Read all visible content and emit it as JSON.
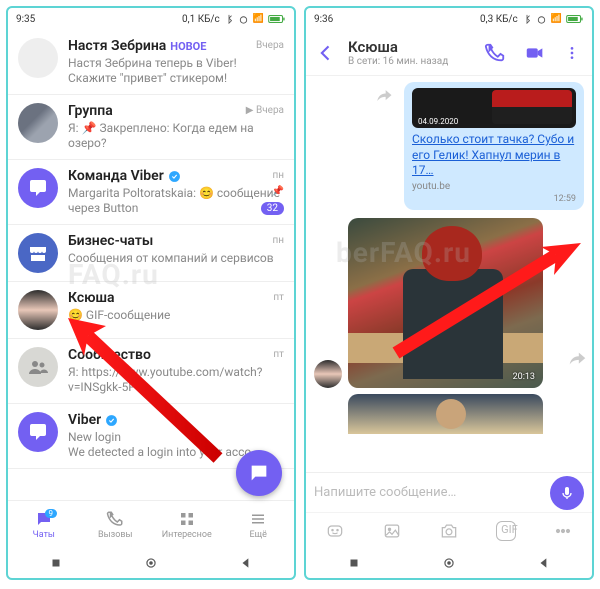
{
  "left": {
    "status": {
      "time": "9:35",
      "net": "0,1 КБ/с"
    },
    "chats": [
      {
        "title": "Настя Зебрина",
        "new": "НОВОЕ",
        "sub": "Настя Зебрина теперь в Viber! Скажите \"привет\" стикером!",
        "meta": "Вчера",
        "avatar": "blank"
      },
      {
        "title": "Группа",
        "sub": "Я: 📌 Закреплено: Когда едем на озеро?",
        "meta": "▶ Вчера",
        "avatar": "photo"
      },
      {
        "title": "Команда Viber",
        "verified": true,
        "sub": "Margarita Poltoratskaia: 😊 сообщение через Button",
        "meta": "пн",
        "count": "32",
        "avatar": "viber"
      },
      {
        "title": "Бизнес-чаты",
        "sub": "Сообщения от компаний и сервисов",
        "meta": "пн",
        "avatar": "biz"
      },
      {
        "title": "Ксюша",
        "sub": "😊 GIF-сообщение",
        "meta": "пт",
        "avatar": "ksu"
      },
      {
        "title": "Сообщество",
        "sub": "Я: https://www.youtube.com/watch?v=INSgkk-5Pco",
        "meta": "пт",
        "avatar": "group"
      },
      {
        "title": "Viber",
        "verified": true,
        "sub": "New login\nWe detected a login into your acco…",
        "meta": "",
        "avatar": "viber"
      }
    ],
    "nav": {
      "chats": "Чаты",
      "chats_badge": "9",
      "calls": "Вызовы",
      "explore": "Интересное",
      "more": "Ещё"
    }
  },
  "right": {
    "status": {
      "time": "9:36",
      "net": "0,3 КБ/с"
    },
    "header": {
      "name": "Ксюша",
      "seen": "В сети: 16 мин. назад"
    },
    "msg_out": {
      "preview_date": "04.09.2020",
      "link": "Сколько стоит тачка? Субо и его Гелик! Хапнул мерин в 17…",
      "domain": "youtu.be",
      "time": "12:59"
    },
    "gif1_time": "20:13",
    "input_placeholder": "Напишите сообщение…",
    "gif_label": "GIF"
  },
  "watermark": "berFAQ.ru"
}
